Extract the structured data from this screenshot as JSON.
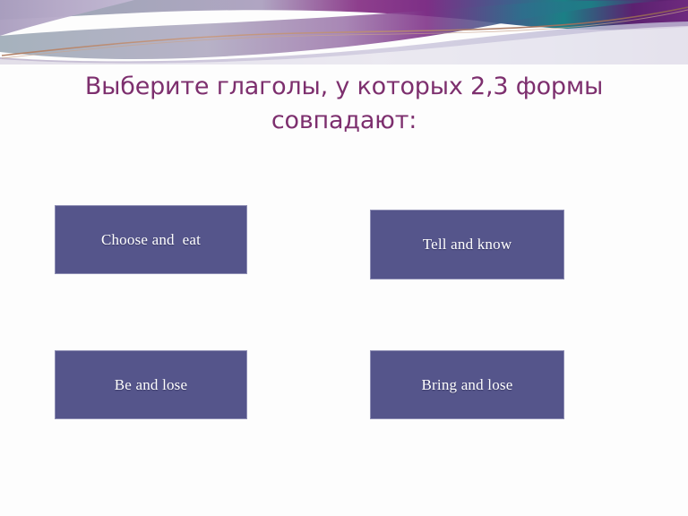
{
  "slide": {
    "title": "Выберите глаголы, у которых 2,3 формы\nсовпадают:",
    "title_color": "#7d2f6e",
    "background_color": "#fdfdfd"
  },
  "banner": {
    "name": "decorative-wave-banner",
    "colors": {
      "steel_blue": "#9aa8b4",
      "lavender": "#b3a8c4",
      "purple": "#7d2f86",
      "deep_purple": "#5c2170",
      "teal": "#1b8086",
      "light_lavender": "#c9c6dd",
      "copper_line": "#b5846a"
    }
  },
  "options": {
    "fill_color": "#55558b",
    "border_color": "#8d8db3",
    "text_color": "#ffffff",
    "items": [
      {
        "id": "choose-eat",
        "label": "Choose and  eat"
      },
      {
        "id": "tell-know",
        "label": "Tell and know"
      },
      {
        "id": "be-lose",
        "label": "Be and lose"
      },
      {
        "id": "bring-lose",
        "label": "Bring and lose"
      }
    ]
  }
}
